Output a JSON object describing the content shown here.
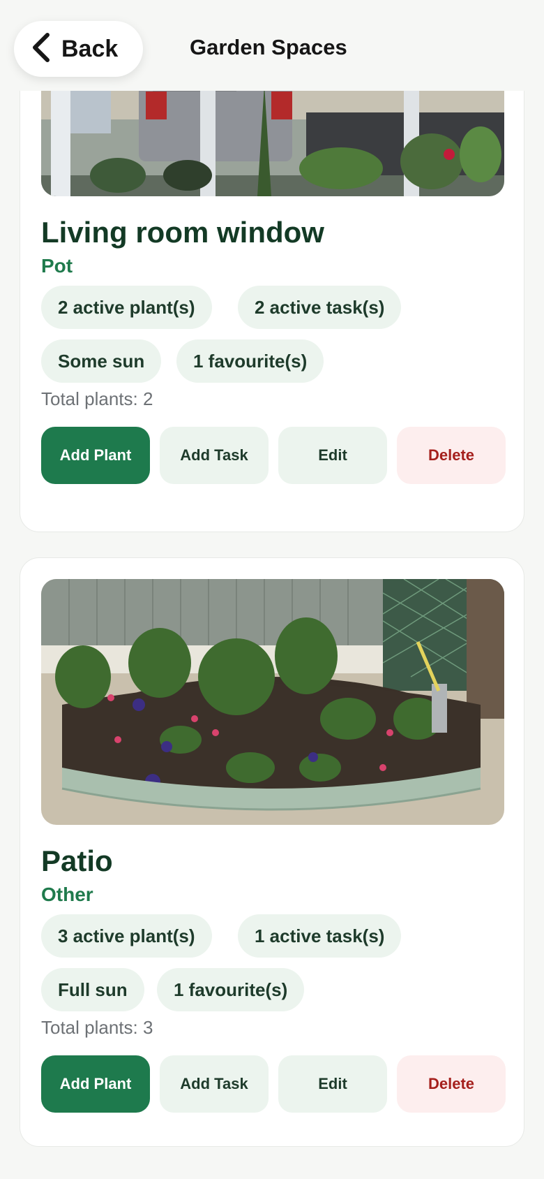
{
  "header": {
    "back_label": "Back",
    "title": "Garden Spaces"
  },
  "spaces": [
    {
      "name": "Living room window",
      "type": "Pot",
      "chips": [
        "2 active plant(s)",
        "2 active task(s)",
        "Some sun",
        "1 favourite(s)"
      ],
      "total_plants": "Total plants: 2"
    },
    {
      "name": "Patio",
      "type": "Other",
      "chips": [
        "3 active plant(s)",
        "1 active task(s)",
        "Full sun",
        "1 favourite(s)"
      ],
      "total_plants": "Total plants: 3"
    }
  ],
  "actions": {
    "add_plant": "Add Plant",
    "add_task": "Add Task",
    "edit": "Edit",
    "delete": "Delete"
  },
  "colors": {
    "brand_green": "#1e7a4d",
    "title_green": "#133a25",
    "type_green": "#1f7a4c",
    "chip_bg": "#ecf4ee",
    "delete_bg": "#fdeeee",
    "delete_text": "#a5201d"
  },
  "icons": {
    "back": "chevron-left-icon"
  }
}
